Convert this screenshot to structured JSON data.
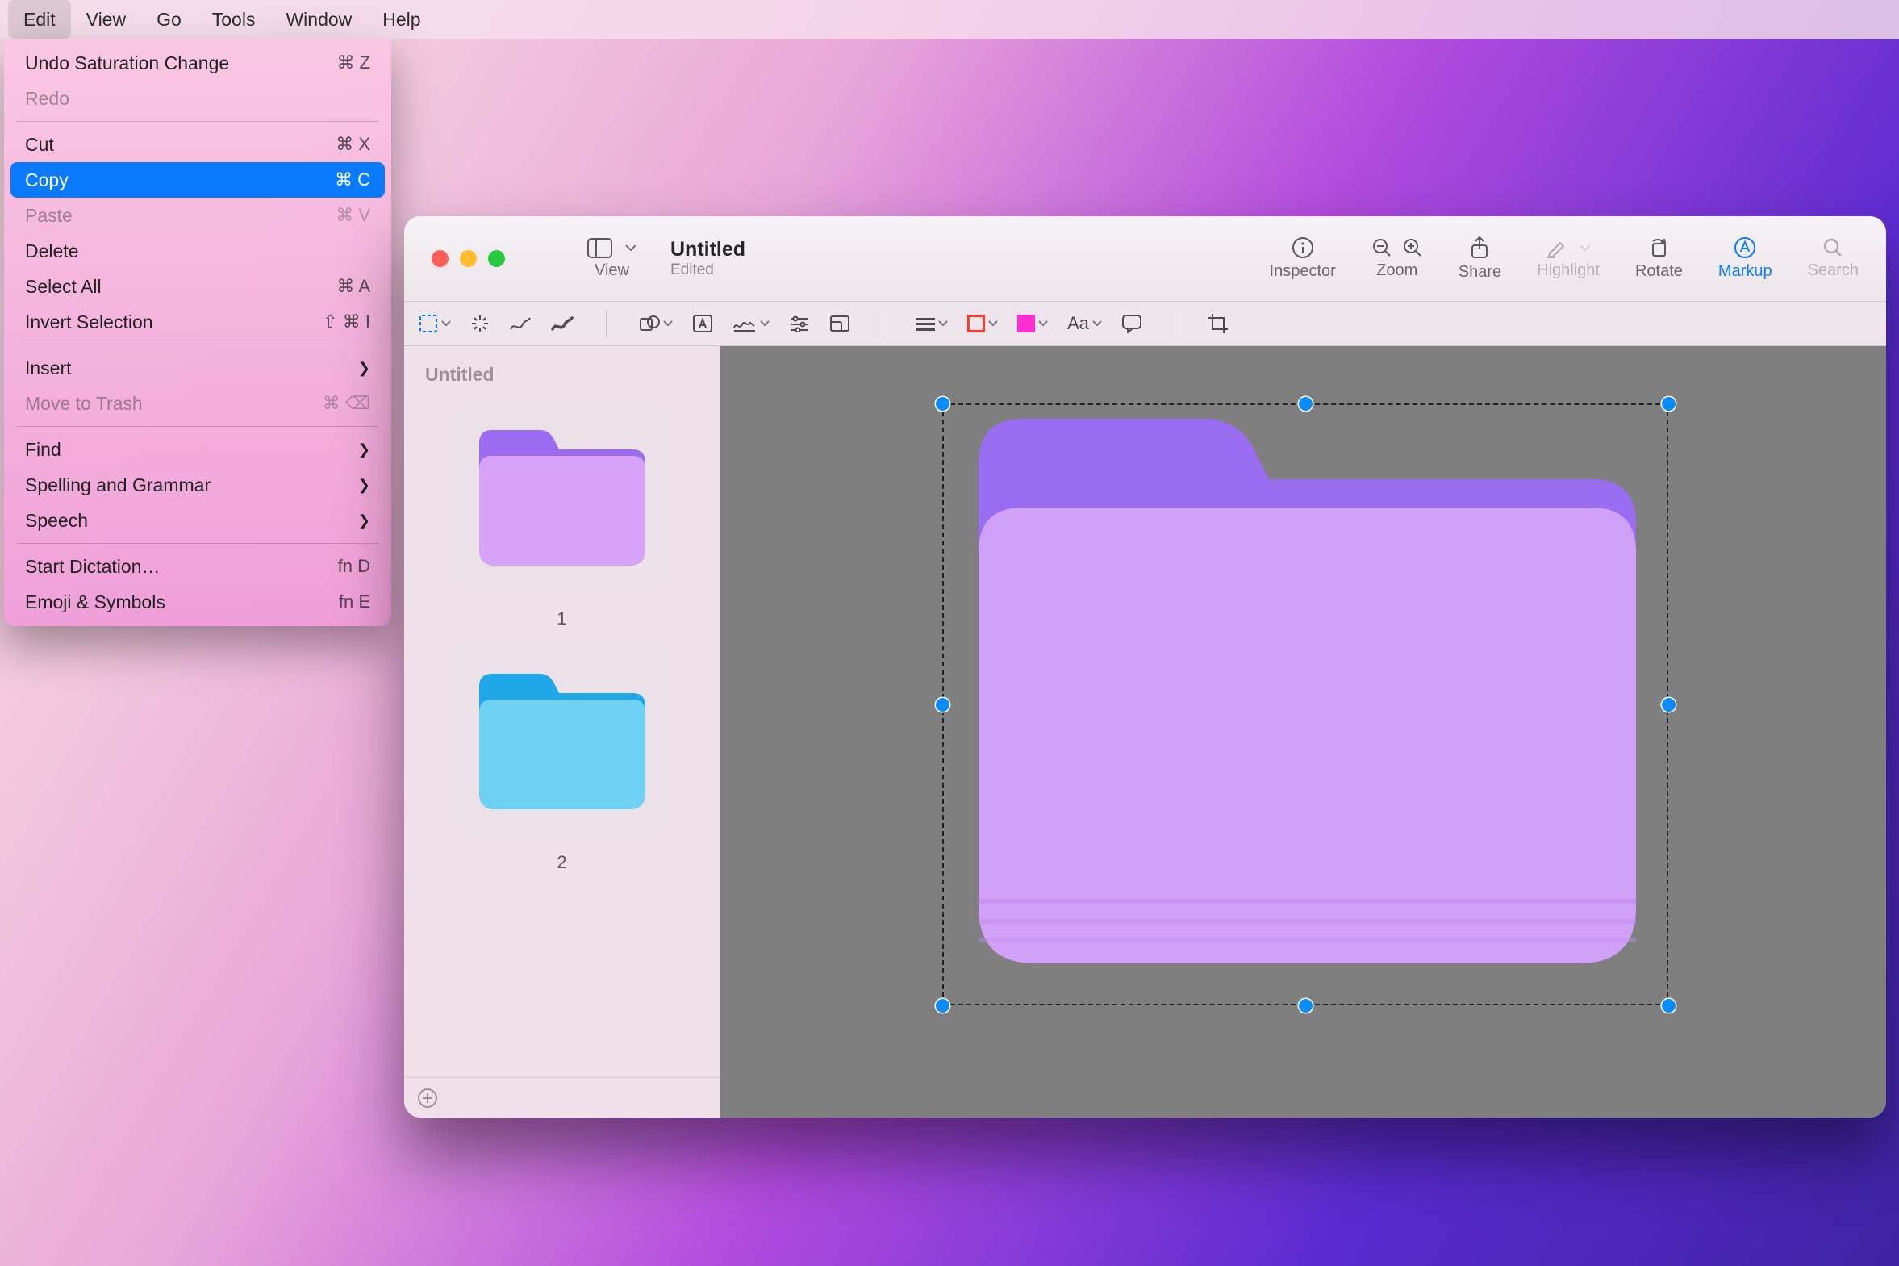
{
  "menubar": {
    "items": [
      "Edit",
      "View",
      "Go",
      "Tools",
      "Window",
      "Help"
    ],
    "activeIndex": 0
  },
  "dropdown": {
    "groups": [
      [
        {
          "label": "Undo Saturation Change",
          "shortcut": "⌘ Z"
        },
        {
          "label": "Redo",
          "shortcut": "",
          "disabled": true
        }
      ],
      [
        {
          "label": "Cut",
          "shortcut": "⌘ X"
        },
        {
          "label": "Copy",
          "shortcut": "⌘ C",
          "highlight": true
        },
        {
          "label": "Paste",
          "shortcut": "⌘ V",
          "disabled": true
        },
        {
          "label": "Delete",
          "shortcut": ""
        },
        {
          "label": "Select All",
          "shortcut": "⌘ A"
        },
        {
          "label": "Invert Selection",
          "shortcut": "⇧ ⌘  I"
        }
      ],
      [
        {
          "label": "Insert",
          "submenu": true
        },
        {
          "label": "Move to Trash",
          "shortcut": "⌘ ⌫",
          "disabled": true
        }
      ],
      [
        {
          "label": "Find",
          "submenu": true
        },
        {
          "label": "Spelling and Grammar",
          "submenu": true
        },
        {
          "label": "Speech",
          "submenu": true
        }
      ],
      [
        {
          "label": "Start Dictation…",
          "shortcut": "fn D"
        },
        {
          "label": "Emoji & Symbols",
          "shortcut": "fn E"
        }
      ]
    ]
  },
  "window": {
    "title": "Untitled",
    "subtitle": "Edited",
    "toolbar": [
      {
        "id": "view",
        "label": "View"
      },
      {
        "id": "inspector",
        "label": "Inspector"
      },
      {
        "id": "zoom",
        "label": "Zoom"
      },
      {
        "id": "share",
        "label": "Share"
      },
      {
        "id": "highlight",
        "label": "Highlight",
        "disabled": true
      },
      {
        "id": "rotate",
        "label": "Rotate"
      },
      {
        "id": "markup",
        "label": "Markup",
        "active": true
      },
      {
        "id": "search",
        "label": "Search",
        "disabled": true
      }
    ],
    "sidebar": {
      "header": "Untitled",
      "pages": [
        {
          "number": "1",
          "color": "purple"
        },
        {
          "number": "2",
          "color": "blue"
        }
      ]
    },
    "markupTools": {
      "textStyle": "Aa",
      "strokeColor": "#ff3b30",
      "fillColor": "#ff2ed2"
    }
  }
}
